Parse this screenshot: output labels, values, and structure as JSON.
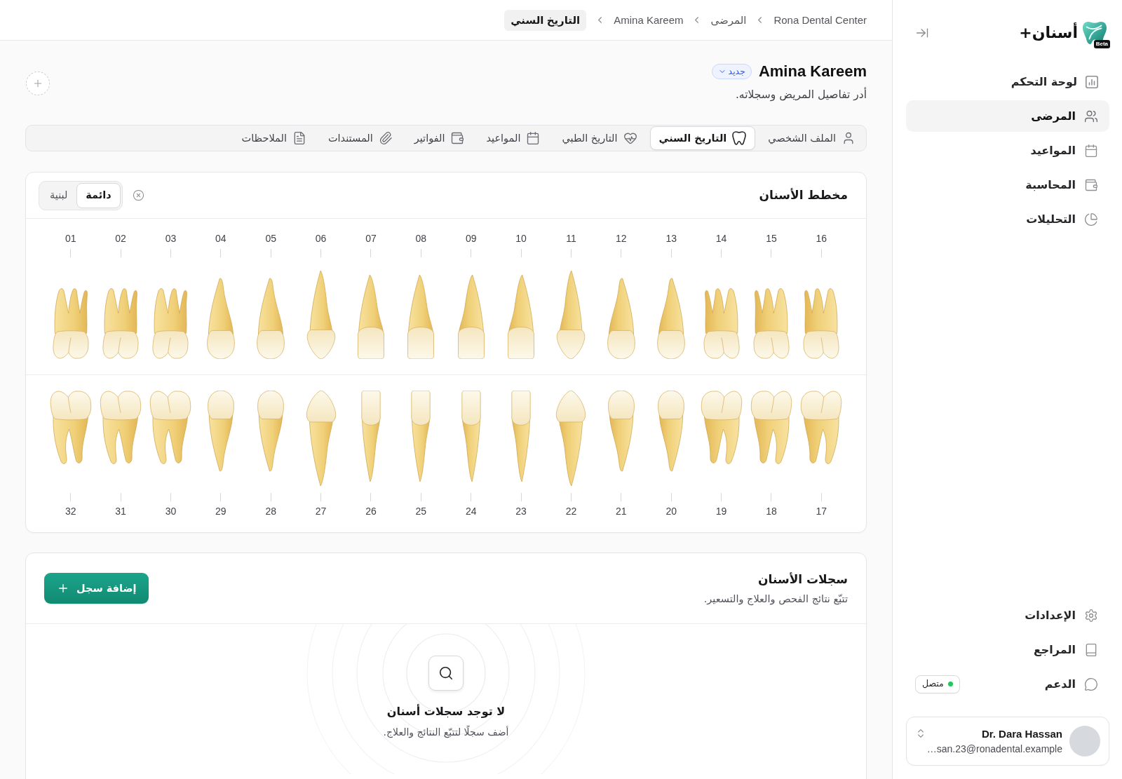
{
  "sidebar": {
    "logo_text": "أسنان+",
    "logo_badge": "Beta",
    "nav": [
      {
        "label": "لوحة التحكم",
        "selected": false
      },
      {
        "label": "المرضى",
        "selected": true
      },
      {
        "label": "المواعيد",
        "selected": false
      },
      {
        "label": "المحاسبة",
        "selected": false
      },
      {
        "label": "التحليلات",
        "selected": false
      }
    ],
    "footer_nav": [
      {
        "label": "الإعدادات",
        "selected": false
      },
      {
        "label": "المراجع",
        "selected": false
      },
      {
        "label": "الدعم",
        "selected": false
      }
    ],
    "support_status": {
      "label": "متصل",
      "online": true
    },
    "user": {
      "name": "Dr. Dara Hassan",
      "email": "…san.23@ronadental.example"
    }
  },
  "breadcrumbs": [
    {
      "label": "Rona Dental Center",
      "current": false
    },
    {
      "label": "المرضى",
      "current": false
    },
    {
      "label": "Amina Kareem",
      "current": false
    },
    {
      "label": "التاريخ السني",
      "current": true
    }
  ],
  "patient": {
    "name": "Amina Kareem",
    "status": "جديد",
    "subtitle": "أدر تفاصيل المريض وسجلاته."
  },
  "tabs": [
    {
      "label": "الملف الشخصي",
      "selected": false
    },
    {
      "label": "التاريخ السني",
      "selected": true
    },
    {
      "label": "التاريخ الطبي",
      "selected": false
    },
    {
      "label": "المواعيد",
      "selected": false
    },
    {
      "label": "الفواتير",
      "selected": false
    },
    {
      "label": "المستندات",
      "selected": false
    },
    {
      "label": "الملاحظات",
      "selected": false
    }
  ],
  "tooth_chart": {
    "title": "مخطط الأسنان",
    "dentition": [
      {
        "label": "دائمة",
        "selected": true
      },
      {
        "label": "لبنية",
        "selected": false
      }
    ],
    "upper_teeth": [
      {
        "number": "16",
        "kind": "molar"
      },
      {
        "number": "15",
        "kind": "molar"
      },
      {
        "number": "14",
        "kind": "molar"
      },
      {
        "number": "13",
        "kind": "premolar"
      },
      {
        "number": "12",
        "kind": "premolar"
      },
      {
        "number": "11",
        "kind": "canine"
      },
      {
        "number": "10",
        "kind": "incisor"
      },
      {
        "number": "09",
        "kind": "incisor"
      },
      {
        "number": "08",
        "kind": "incisor"
      },
      {
        "number": "07",
        "kind": "incisor"
      },
      {
        "number": "06",
        "kind": "canine"
      },
      {
        "number": "05",
        "kind": "premolar"
      },
      {
        "number": "04",
        "kind": "premolar"
      },
      {
        "number": "03",
        "kind": "molar"
      },
      {
        "number": "02",
        "kind": "molar"
      },
      {
        "number": "01",
        "kind": "molar"
      }
    ],
    "lower_teeth": [
      {
        "number": "17",
        "kind": "molar"
      },
      {
        "number": "18",
        "kind": "molar"
      },
      {
        "number": "19",
        "kind": "molar"
      },
      {
        "number": "20",
        "kind": "premolar"
      },
      {
        "number": "21",
        "kind": "premolar"
      },
      {
        "number": "22",
        "kind": "canine"
      },
      {
        "number": "23",
        "kind": "incisor"
      },
      {
        "number": "24",
        "kind": "incisor"
      },
      {
        "number": "25",
        "kind": "incisor"
      },
      {
        "number": "26",
        "kind": "incisor"
      },
      {
        "number": "27",
        "kind": "canine"
      },
      {
        "number": "28",
        "kind": "premolar"
      },
      {
        "number": "29",
        "kind": "premolar"
      },
      {
        "number": "30",
        "kind": "molar"
      },
      {
        "number": "31",
        "kind": "molar"
      },
      {
        "number": "32",
        "kind": "molar"
      }
    ]
  },
  "dental_records": {
    "title": "سجلات الأسنان",
    "subtitle": "تتبّع نتائج الفحص والعلاج والتسعير.",
    "add_button": "إضافة سجل",
    "empty_title": "لا توجد سجلات أسنان",
    "empty_text": "أضف سجلًا لتتبّع النتائج والعلاج."
  }
}
